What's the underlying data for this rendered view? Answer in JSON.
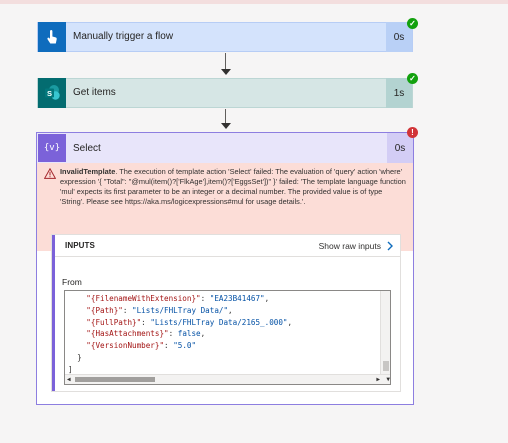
{
  "steps": [
    {
      "title": "Manually trigger a flow",
      "duration": "0s",
      "status": "success",
      "icon": "hand-touch-icon"
    },
    {
      "title": "Get items",
      "duration": "1s",
      "status": "success",
      "icon": "sharepoint-icon"
    }
  ],
  "select": {
    "title": "Select",
    "duration": "0s",
    "status": "error",
    "icon_glyph": "{v}",
    "error": {
      "heading": "InvalidTemplate",
      "message": ". The execution of template action 'Select' failed: The evaluation of 'query' action 'where' expression '{ \"Total\": \"@mul(item()?['FlkAge'],item()?['EggsSet'])\" }' failed: 'The template language function 'mul' expects its first parameter to be an integer or a decimal number. The provided value is of type 'String'. Please see https://aka.ms/logicexpressions#mul for usage details.'."
    },
    "inputs": {
      "header": "INPUTS",
      "show_raw": "Show raw inputs",
      "from_label": "From",
      "code_lines": [
        {
          "key": "\"{FilenameWithExtension}\"",
          "value": "\"EA23B41467\"",
          "suffix": ","
        },
        {
          "key": "\"{Path}\"",
          "value": "\"Lists/FHLTray Data/\"",
          "suffix": ","
        },
        {
          "key": "\"{FullPath}\"",
          "value": "\"Lists/FHLTray Data/2165_.000\"",
          "suffix": ","
        },
        {
          "key": "\"{HasAttachments}\"",
          "value": "false",
          "suffix": ","
        },
        {
          "key": "\"{VersionNumber}\"",
          "value": "\"5.0\"",
          "suffix": ""
        },
        {
          "key": "",
          "value": "",
          "suffix": "}"
        },
        {
          "key": "",
          "value": "",
          "suffix": "]"
        }
      ]
    }
  },
  "colors": {
    "success": "#13a10e",
    "error": "#d13438",
    "select_accent": "#7b62d9"
  }
}
